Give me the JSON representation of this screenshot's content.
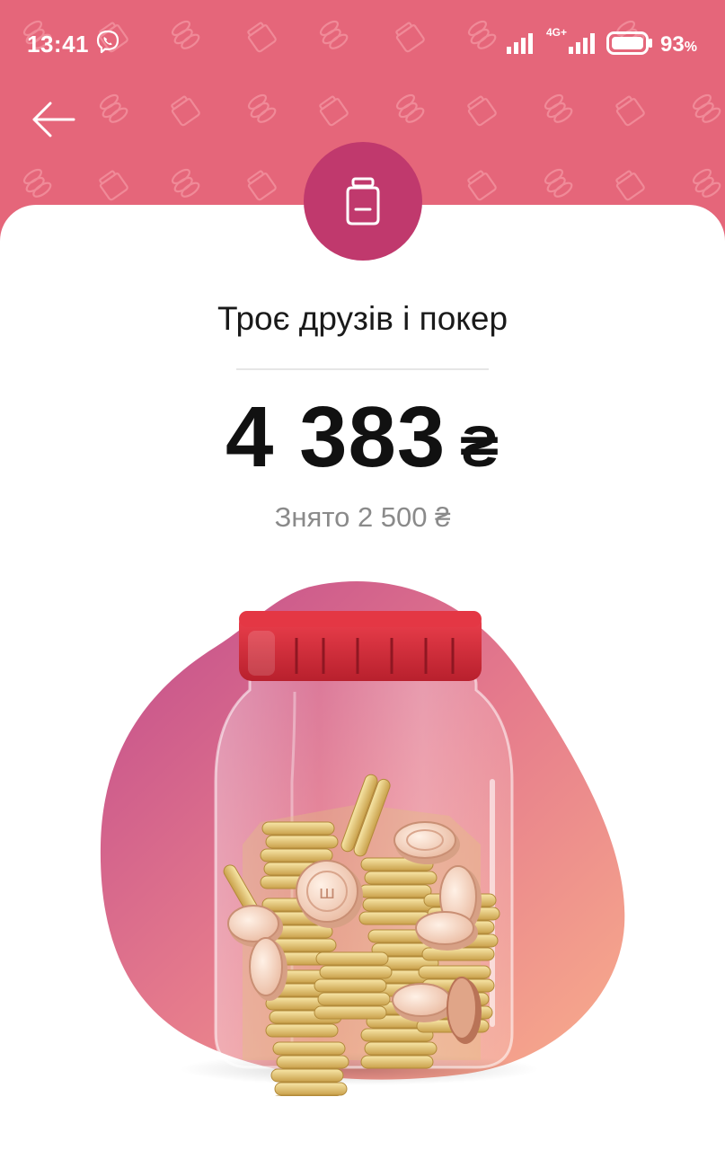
{
  "status_bar": {
    "time": "13:41",
    "network": "4G+",
    "battery_percent": "93",
    "battery_unit": "%"
  },
  "header": {
    "background_color": "#e5667a",
    "back_icon": "arrow-left-icon"
  },
  "jar": {
    "badge_icon": "jar-icon",
    "badge_color": "#c0396d",
    "title": "Троє друзів і покер",
    "balance": "4 383",
    "currency": "₴",
    "withdrawn": "Знято 2 500 ₴"
  },
  "illustration": {
    "name": "coin-jar-illustration",
    "lid_color": "#d9303f",
    "blob_gradient": [
      "#c04b8c",
      "#f6a68a"
    ]
  }
}
